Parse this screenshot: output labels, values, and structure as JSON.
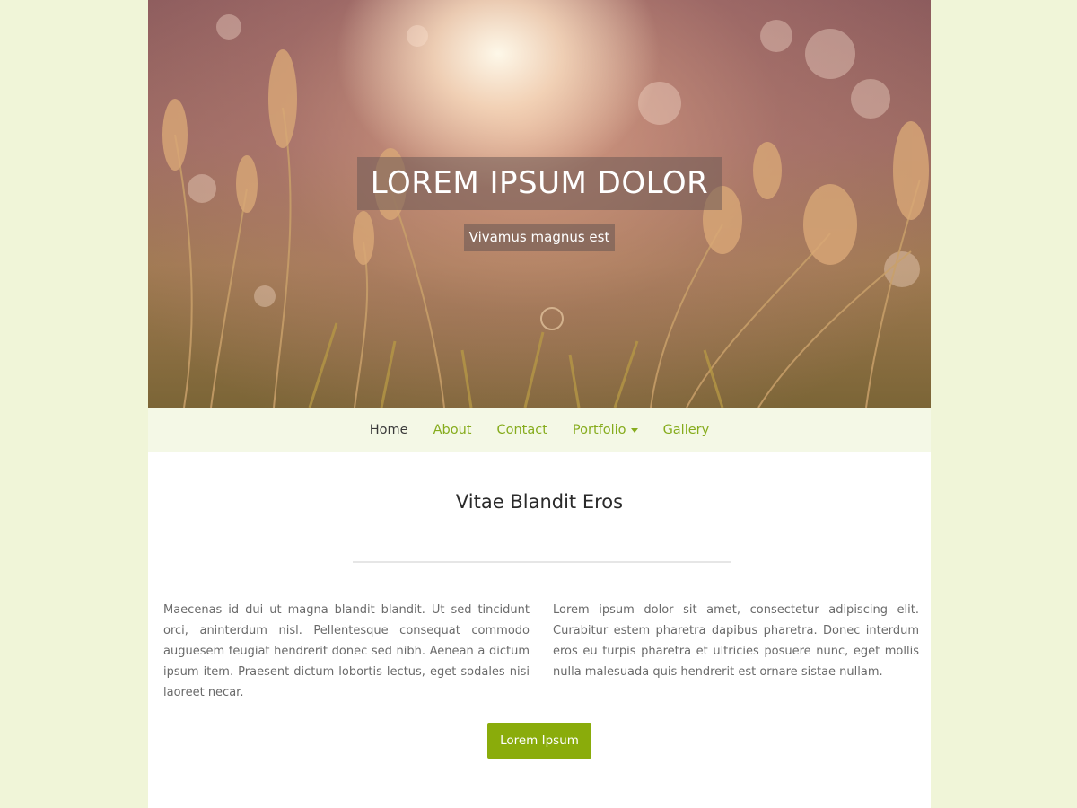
{
  "hero": {
    "title": "LOREM IPSUM DOLOR",
    "subtitle": "Vivamus magnus est"
  },
  "nav": {
    "items": [
      {
        "label": "Home",
        "active": true
      },
      {
        "label": "About",
        "active": false
      },
      {
        "label": "Contact",
        "active": false
      },
      {
        "label": "Portfolio",
        "active": false,
        "has_dropdown": true
      },
      {
        "label": "Gallery",
        "active": false
      }
    ]
  },
  "main": {
    "title": "Vitae Blandit Eros",
    "col_left": "Maecenas id dui ut magna blandit blandit. Ut sed tincidunt orci, aninterdum nisl. Pellentesque consequat commodo auguesem feugiat hendrerit donec sed nibh. Aenean a dictum ipsum item. Praesent dictum lobortis lectus, eget sodales nisi laoreet necar.",
    "col_right": "Lorem ipsum dolor sit amet, consectetur adipiscing elit. Curabitur estem pharetra dapibus pharetra. Donec interdum eros eu turpis pharetra et ultricies posuere nunc, eget mollis nulla malesuada quis hendrerit est ornare sistae nullam.",
    "button_label": "Lorem Ipsum"
  },
  "colors": {
    "background": "#f0f5d8",
    "accent": "#8aac0b",
    "nav_link": "#86ac1d",
    "nav_background": "#f4f8e6"
  },
  "icons": {
    "dropdown": "caret-down-icon"
  }
}
